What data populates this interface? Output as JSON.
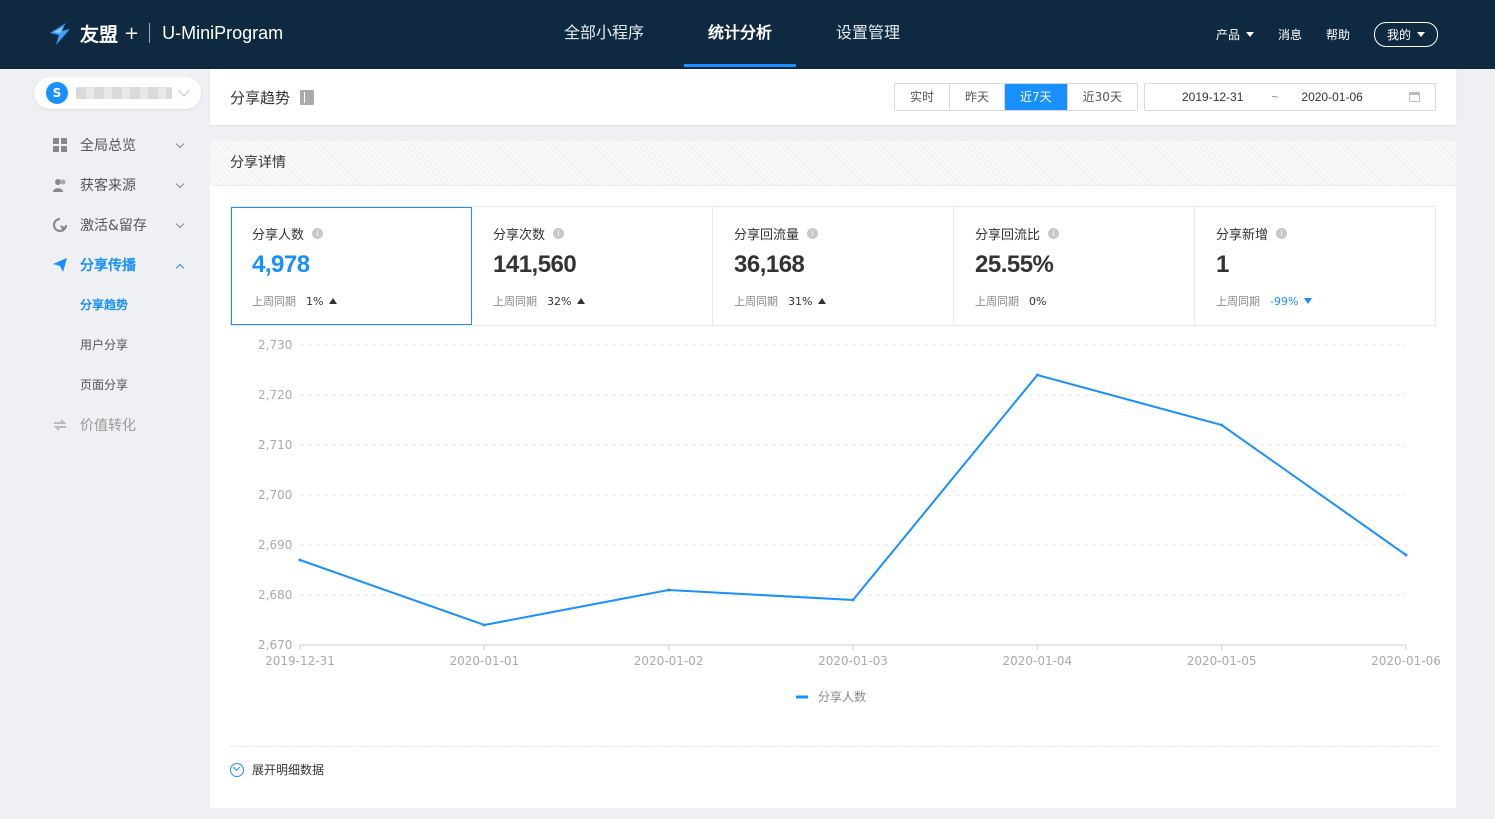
{
  "topbar": {
    "brand": "友盟",
    "brand_plus": "+",
    "app_name": "U-MiniProgram",
    "nav": [
      {
        "label": "全部小程序",
        "active": false
      },
      {
        "label": "统计分析",
        "active": true
      },
      {
        "label": "设置管理",
        "active": false
      }
    ],
    "right": {
      "product": "产品",
      "messages": "消息",
      "help": "帮助",
      "me": "我的"
    }
  },
  "sidebar": {
    "menu": [
      {
        "label": "全局总览",
        "icon": "grid-icon",
        "state": "collapsed"
      },
      {
        "label": "获客来源",
        "icon": "users-icon",
        "state": "collapsed"
      },
      {
        "label": "激活&留存",
        "icon": "cursor-icon",
        "state": "collapsed"
      },
      {
        "label": "分享传播",
        "icon": "send-icon",
        "state": "open"
      }
    ],
    "submenu": [
      {
        "label": "分享趋势",
        "active": true
      },
      {
        "label": "用户分享",
        "active": false
      },
      {
        "label": "页面分享",
        "active": false
      }
    ],
    "extra": {
      "label": "价值转化",
      "icon": "exchange-icon"
    }
  },
  "header": {
    "title": "分享趋势",
    "ranges": [
      {
        "label": "实时",
        "active": false
      },
      {
        "label": "昨天",
        "active": false
      },
      {
        "label": "近7天",
        "active": true
      },
      {
        "label": "近30天",
        "active": false
      }
    ],
    "date_start": "2019-12-31",
    "date_tilde": "~",
    "date_end": "2020-01-06"
  },
  "section": {
    "title": "分享详情",
    "compare_label": "上周同期",
    "metrics": [
      {
        "label": "分享人数",
        "value": "4,978",
        "change": "1%",
        "dir": "up",
        "active": true
      },
      {
        "label": "分享次数",
        "value": "141,560",
        "change": "32%",
        "dir": "up",
        "active": false
      },
      {
        "label": "分享回流量",
        "value": "36,168",
        "change": "31%",
        "dir": "up",
        "active": false
      },
      {
        "label": "分享回流比",
        "value": "25.55%",
        "change": "0%",
        "dir": "none",
        "active": false
      },
      {
        "label": "分享新增",
        "value": "1",
        "change": "-99%",
        "dir": "down",
        "active": false
      }
    ],
    "expand_label": "展开明细数据"
  },
  "colors": {
    "accent": "#1890ff",
    "topbar": "#0f2a40"
  },
  "chart_data": {
    "type": "line",
    "categories": [
      "2019-12-31",
      "2020-01-01",
      "2020-01-02",
      "2020-01-03",
      "2020-01-04",
      "2020-01-05",
      "2020-01-06"
    ],
    "series": [
      {
        "name": "分享人数",
        "values": [
          2687,
          2674,
          2681,
          2679,
          2724,
          2714,
          2688
        ]
      }
    ],
    "ylim": [
      2670,
      2730
    ],
    "yticks": [
      "2,670",
      "2,680",
      "2,690",
      "2,700",
      "2,710",
      "2,720",
      "2,730"
    ],
    "grid": true,
    "legend": "bottom-center"
  }
}
